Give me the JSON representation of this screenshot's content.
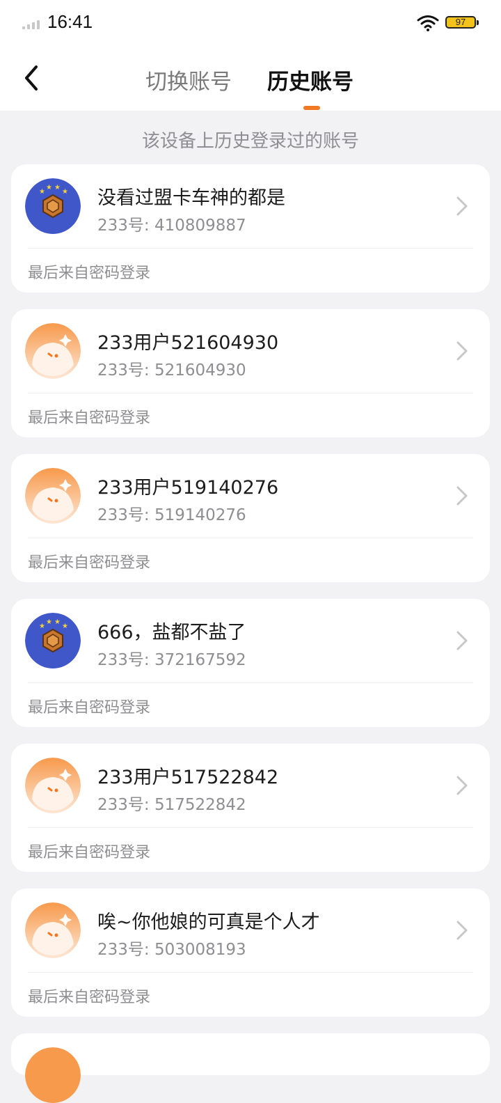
{
  "status_bar": {
    "time": "16:41",
    "battery": "97"
  },
  "header": {
    "tabs": [
      {
        "label": "切换账号",
        "active": false
      },
      {
        "label": "历史账号",
        "active": true
      }
    ]
  },
  "subtitle": "该设备上历史登录过的账号",
  "accounts": [
    {
      "name": "没看过盟卡车神的都是",
      "id": "233号: 410809887",
      "source": "最后来自密码登录",
      "avatar": "badge-avatar"
    },
    {
      "name": "233用户521604930",
      "id": "233号: 521604930",
      "source": "最后来自密码登录",
      "avatar": "default-avatar"
    },
    {
      "name": "233用户519140276",
      "id": "233号: 519140276",
      "source": "最后来自密码登录",
      "avatar": "default-avatar"
    },
    {
      "name": "666，盐都不盐了",
      "id": "233号: 372167592",
      "source": "最后来自密码登录",
      "avatar": "badge-avatar"
    },
    {
      "name": "233用户517522842",
      "id": "233号: 517522842",
      "source": "最后来自密码登录",
      "avatar": "default-avatar"
    },
    {
      "name": "唉~你他娘的可真是个人才",
      "id": "233号: 503008193",
      "source": "最后来自密码登录",
      "avatar": "default-avatar"
    }
  ],
  "colors": {
    "accent": "#f07a23",
    "background": "#f2f2f4",
    "badge_bg": "#3f57c9"
  }
}
